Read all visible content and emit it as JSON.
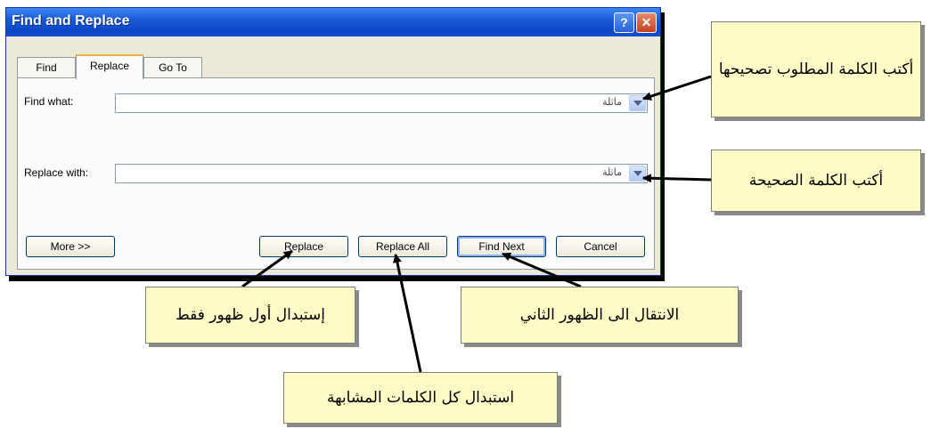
{
  "dialog": {
    "title": "Find and Replace",
    "help_button": "?",
    "close_button": "✕",
    "tabs": [
      {
        "label": "Find",
        "active": false
      },
      {
        "label": "Replace",
        "active": true
      },
      {
        "label": "Go To",
        "active": false
      }
    ],
    "find_what": {
      "label": "Find what:",
      "value": "ماثلة"
    },
    "replace_with": {
      "label": "Replace with:",
      "value": "ماثلة"
    },
    "buttons": {
      "more": "More >>",
      "replace": "Replace",
      "replace_all": "Replace All",
      "find_next": "Find Next",
      "cancel": "Cancel"
    }
  },
  "callouts": {
    "find_word": "أكتب الكلمة المطلوب تصحيحها",
    "correct_word": "أكتب الكلمة الصحيحة",
    "replace_first": "إستبدال أول ظهور فقط",
    "go_next": "الانتقال الى الظهور الثاني",
    "replace_all": "استبدال كل الكلمات المشابهة"
  }
}
